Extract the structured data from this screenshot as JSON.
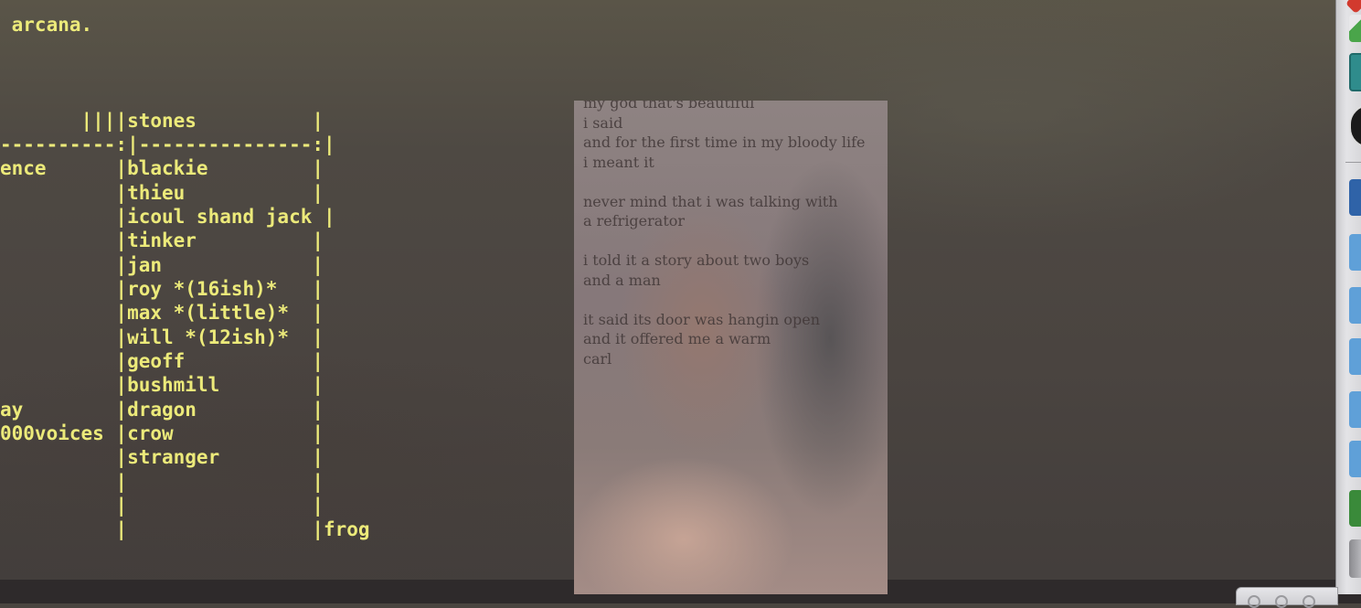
{
  "terminal": {
    "header": " arcana.",
    "table_lines": [
      "       ||||stones          |",
      "----------:|---------------:|",
      "ence      |blackie         |",
      "          |thieu           |",
      "          |icoul shand jack |",
      "          |tinker          |",
      "          |jan             |",
      "          |roy *(16ish)*   |",
      "          |max *(little)*  |",
      "          |will *(12ish)*  |",
      "          |geoff           |",
      "          |bushmill        |",
      "ay        |dragon          |",
      "000voices |crow            |",
      "          |stranger        |",
      "          |                |",
      "          |                |",
      "          |                |frog"
    ],
    "text_color": "#ecea7a"
  },
  "poem_window": {
    "lines": [
      "my god that's beautiful",
      "i said",
      "and for the first time in my bloody life",
      "i meant it",
      "",
      "never mind that i was talking with",
      "a refrigerator",
      "",
      "i told it a story about two boys",
      "and a man",
      "",
      "it said its door was hangin open",
      "and it offered me a warm",
      "carl"
    ]
  },
  "dock": {
    "icons": [
      {
        "name": "red-x-icon",
        "color": "#d23a2e"
      },
      {
        "name": "green-arrow-icon",
        "color": "#4aa54a"
      },
      {
        "name": "teal-app-icon",
        "color": "#2f8c8c"
      },
      {
        "name": "black-circle-app-icon",
        "color": "#1a1a1a"
      },
      {
        "name": "blue-case-icon",
        "color": "#2f63a8"
      },
      {
        "name": "folder-icon",
        "color": "#5fa0d8"
      },
      {
        "name": "folder-icon",
        "color": "#5fa0d8"
      },
      {
        "name": "folder-icon",
        "color": "#5fa0d8"
      },
      {
        "name": "folder-icon",
        "color": "#5fa0d8"
      },
      {
        "name": "folder-icon",
        "color": "#5fa0d8"
      },
      {
        "name": "green-folder-icon",
        "color": "#3a8a3a"
      },
      {
        "name": "trash-icon",
        "color": "#9a9a9e"
      }
    ]
  }
}
